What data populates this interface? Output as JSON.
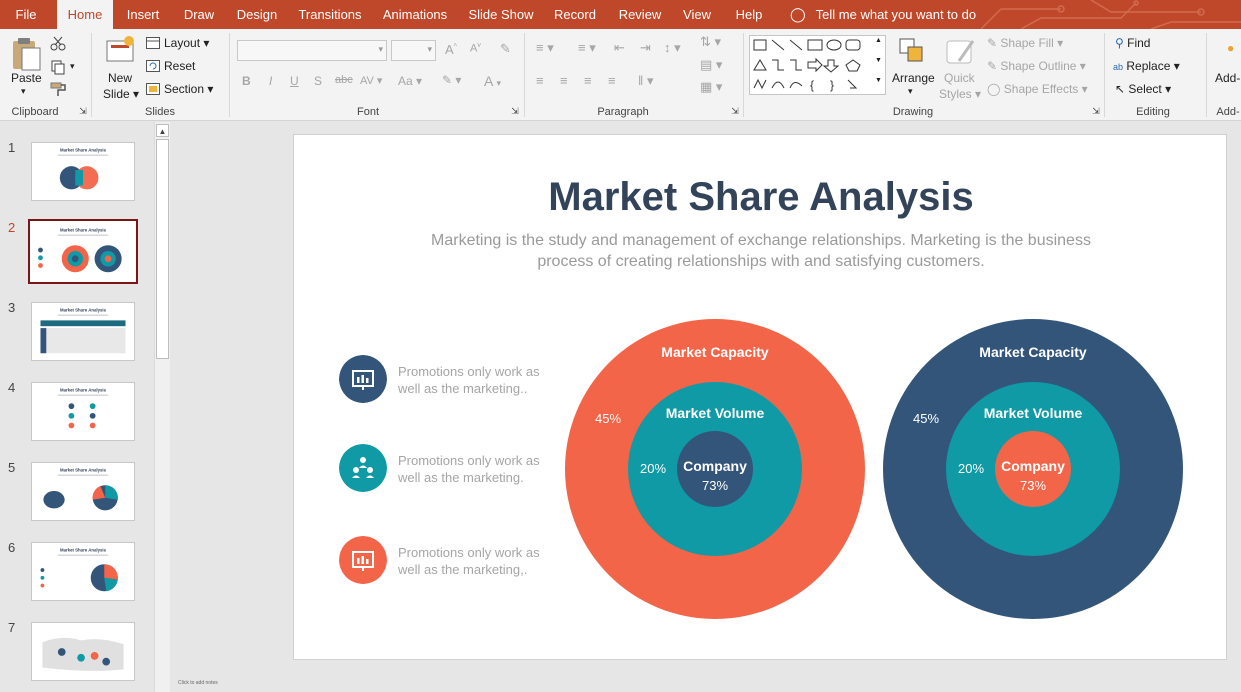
{
  "ribbon_tabs": [
    "File",
    "Home",
    "Insert",
    "Draw",
    "Design",
    "Transitions",
    "Animations",
    "Slide Show",
    "Record",
    "Review",
    "View",
    "Help"
  ],
  "active_tab": "Home",
  "tell_me": "Tell me what you want to do",
  "clipboard": {
    "paste": "Paste",
    "label": "Clipboard"
  },
  "slides_group": {
    "new_slide_1": "New",
    "new_slide_2": "Slide",
    "layout": "Layout",
    "reset": "Reset",
    "section": "Section",
    "label": "Slides"
  },
  "font_group": {
    "label": "Font",
    "bold": "B",
    "italic": "I",
    "underline": "U",
    "shadow": "S",
    "strike": "abc",
    "spacing": "AV",
    "case": "Aa"
  },
  "paragraph_group": {
    "label": "Paragraph"
  },
  "drawing_group": {
    "arrange": "Arrange",
    "quick_styles_1": "Quick",
    "quick_styles_2": "Styles",
    "shape_fill": "Shape Fill",
    "shape_outline": "Shape Outline",
    "shape_effects": "Shape Effects",
    "label": "Drawing"
  },
  "editing_group": {
    "find": "Find",
    "replace": "Replace",
    "select": "Select",
    "label": "Editing"
  },
  "addins": {
    "label_top": "Add-",
    "label_bottom": "Add-"
  },
  "thumbnails": [
    {
      "num": "1",
      "title": "Market Share Analysis"
    },
    {
      "num": "2",
      "title": "Market Share Analysis"
    },
    {
      "num": "3",
      "title": "Market Share Analysis"
    },
    {
      "num": "4",
      "title": "Market Share Analysis"
    },
    {
      "num": "5",
      "title": "Market Share Analysis"
    },
    {
      "num": "6",
      "title": "Market Share Analysis"
    },
    {
      "num": "7",
      "title": ""
    }
  ],
  "selected_slide": "2",
  "slide": {
    "title": "Market Share Analysis",
    "subtitle_1": "Marketing is the study and management of exchange relationships. Marketing is the business",
    "subtitle_2": "process of creating relationships with and satisfying customers.",
    "features": [
      {
        "line1": "Promotions only work as",
        "line2": "well as the marketing..",
        "icon": "presentation-board-icon",
        "color": "#33557a"
      },
      {
        "line1": "Promotions only work as",
        "line2": "well as the marketing.",
        "icon": "team-icon",
        "color": "#0f9aa5"
      },
      {
        "line1": "Promotions only work as",
        "line2": "well as the marketing,.",
        "icon": "presentation-board-icon",
        "color": "#f26549"
      }
    ],
    "diagrams": [
      {
        "outer_label": "Market Capacity",
        "outer_pct": "45%",
        "mid_label": "Market Volume",
        "mid_pct": "20%",
        "inner_label": "Company",
        "inner_pct": "73%",
        "outer_color": "#f26549",
        "mid_color": "#0f9aa5",
        "inner_color": "#33557a"
      },
      {
        "outer_label": "Market Capacity",
        "outer_pct": "45%",
        "mid_label": "Market Volume",
        "mid_pct": "20%",
        "inner_label": "Company",
        "inner_pct": "73%",
        "outer_color": "#33557a",
        "mid_color": "#0f9aa5",
        "inner_color": "#f26549"
      }
    ]
  },
  "notes_placeholder": "Click to add notes"
}
